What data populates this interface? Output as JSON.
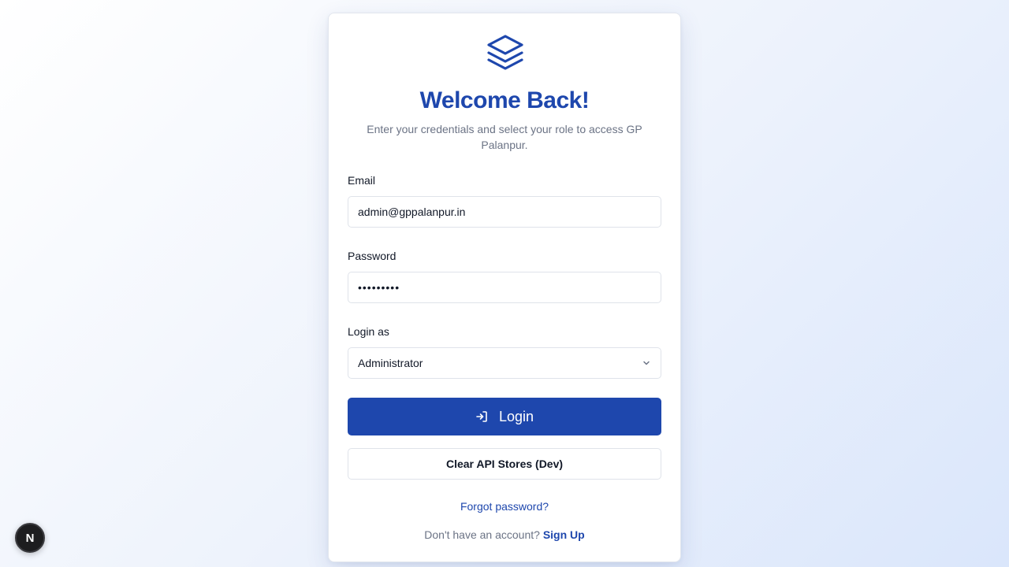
{
  "brand": {
    "icon": "layers-icon",
    "accent_color": "#1e47ad"
  },
  "header": {
    "title": "Welcome Back!",
    "subtitle": "Enter your credentials and select your role to access GP Palanpur."
  },
  "form": {
    "email": {
      "label": "Email",
      "value": "admin@gppalanpur.in"
    },
    "password": {
      "label": "Password",
      "value": "•••••••••"
    },
    "role": {
      "label": "Login as",
      "value": "Administrator",
      "icon": "chevron-down-icon"
    },
    "login_button": {
      "label": "Login",
      "icon": "log-in-icon"
    },
    "clear_button": {
      "label": "Clear API Stores (Dev)"
    }
  },
  "footer": {
    "forgot_password": "Forgot password?",
    "signup_prompt": "Don't have an account?",
    "signup_link": "Sign Up"
  },
  "dev_badge": {
    "letter": "N",
    "icon": "nextjs-icon"
  }
}
